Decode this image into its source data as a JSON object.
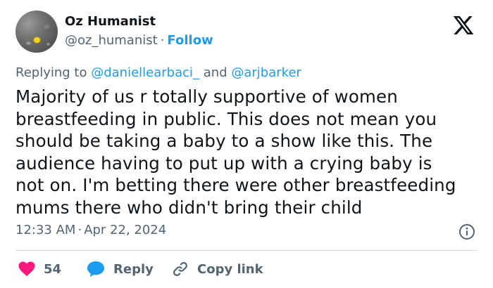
{
  "author": {
    "name": "Oz Humanist",
    "handle": "@oz_humanist",
    "separator": "·",
    "follow_label": "Follow"
  },
  "reply_context": {
    "prefix": "Replying to",
    "mention_1": "@daniellearbaci_",
    "conjunction": "and",
    "mention_2": "@arjbarker"
  },
  "tweet": {
    "lines": [
      "Majority of us r totally supportive of women",
      "breastfeeding in public. This does not mean you",
      "should be taking a baby to a show like this. The",
      "audience having to put up with a crying baby is",
      "not on. I'm betting there were other breastfeeding",
      "mums there who didn't bring their child"
    ],
    "time": "12:33 AM",
    "separator": "·",
    "date": "Apr 22, 2024"
  },
  "actions": {
    "like_count": "54",
    "reply_label": "Reply",
    "copy_label": "Copy link"
  },
  "icons": {
    "brand": "x-logo-icon",
    "info": "info-icon",
    "like": "heart-icon",
    "reply": "speech-bubble-icon",
    "copy": "link-icon"
  },
  "colors": {
    "text_primary": "#0f1419",
    "text_secondary": "#536471",
    "link": "#1d9bf0",
    "like": "#f91880",
    "divider": "#cfd9de"
  }
}
